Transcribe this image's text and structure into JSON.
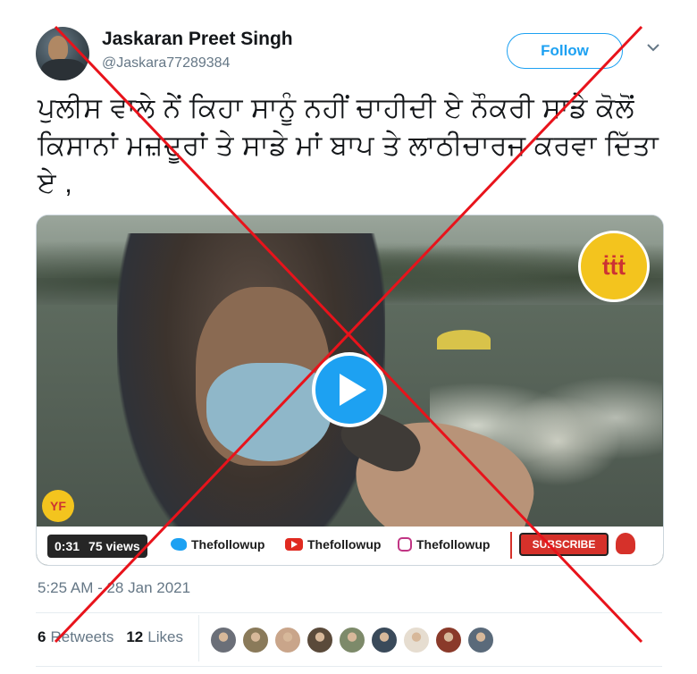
{
  "author": {
    "name": "Jaskaran Preet Singh",
    "handle": "@Jaskara77289384"
  },
  "follow_label": "Follow",
  "tweet_text": "ਪੁਲੀਸ ਵਾਲੇ ਨੇਂ ਕਿਹਾ ਸਾਨੂੰ ਨਹੀਂ ਚਾਹੀਦੀ ਏ ਨੌਕਰੀ ਸਾਡੇ ਕੋਲੋਂ ਕਿਸਾਨਾਂ ਮਜ਼ਦੂਰਾਂ ਤੇ ਸਾਡੇ ਮਾਂ ਬਾਪ ਤੇ ਲਾਠੀਚਾਰਜ ਕਰਵਾ ਦਿੱਤਾ ਏ ,",
  "video": {
    "duration": "0:31",
    "views": "75 views",
    "watermark_items": [
      {
        "icon": "twitter-icon",
        "label": "Thefollowup"
      },
      {
        "icon": "youtube-icon",
        "label": "Thefollowup"
      },
      {
        "icon": "instagram-icon",
        "label": "Thefollowup"
      }
    ],
    "subscribe_label": "SUBSCRIBE"
  },
  "timestamp": "5:25 AM - 28 Jan 2021",
  "stats": {
    "retweets_count": "6",
    "retweets_label": "Retweets",
    "likes_count": "12",
    "likes_label": "Likes"
  },
  "liker_avatar_colors": [
    "#6b6f78",
    "#8a7a5a",
    "#c9a58a",
    "#5a4a3a",
    "#7d8a6a",
    "#3a4a5a",
    "#e6ddd0",
    "#8a3a2a",
    "#5a6a7a"
  ],
  "colors": {
    "accent": "#1da1f2",
    "overlay_cross": "#e8131b",
    "secondary_text": "#657786"
  }
}
